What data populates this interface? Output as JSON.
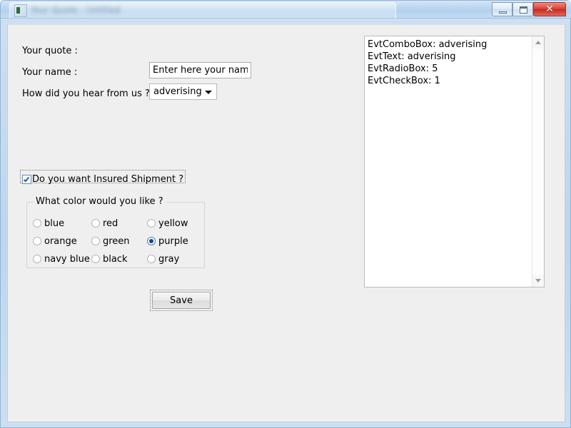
{
  "window": {
    "title": "Your Quote - Untitled",
    "controls": {
      "minimize": "minimize-button",
      "maximize": "maximize-button",
      "close": "✕"
    }
  },
  "form": {
    "quote_label": "Your quote :",
    "name_label": "Your name :",
    "hear_label": "How did you hear from us ?",
    "name_input": {
      "value": "Enter here your name",
      "placeholder": "Enter here your name"
    },
    "combo": {
      "selected": "adverising",
      "options": [
        "adverising"
      ]
    },
    "checkbox": {
      "label": "Do you want Insured Shipment ?",
      "checked": true
    },
    "color_group": {
      "legend": "What color would you like ?",
      "options": [
        {
          "label": "blue",
          "checked": false
        },
        {
          "label": "red",
          "checked": false
        },
        {
          "label": "yellow",
          "checked": false
        },
        {
          "label": "orange",
          "checked": false
        },
        {
          "label": "green",
          "checked": false
        },
        {
          "label": "purple",
          "checked": true
        },
        {
          "label": "navy blue",
          "checked": false
        },
        {
          "label": "black",
          "checked": false
        },
        {
          "label": "gray",
          "checked": false
        }
      ]
    },
    "save_label": "Save"
  },
  "log": {
    "lines": [
      "EvtComboBox: adverising",
      "EvtText: adverising",
      "EvtRadioBox: 5",
      "EvtCheckBox: 1"
    ]
  },
  "colors": {
    "title_bar": "#b9d5f0",
    "client_bg": "#efefef",
    "close_button": "#c32b20",
    "accent_check": "#1d5fa8",
    "radio_dot": "#15458a"
  }
}
